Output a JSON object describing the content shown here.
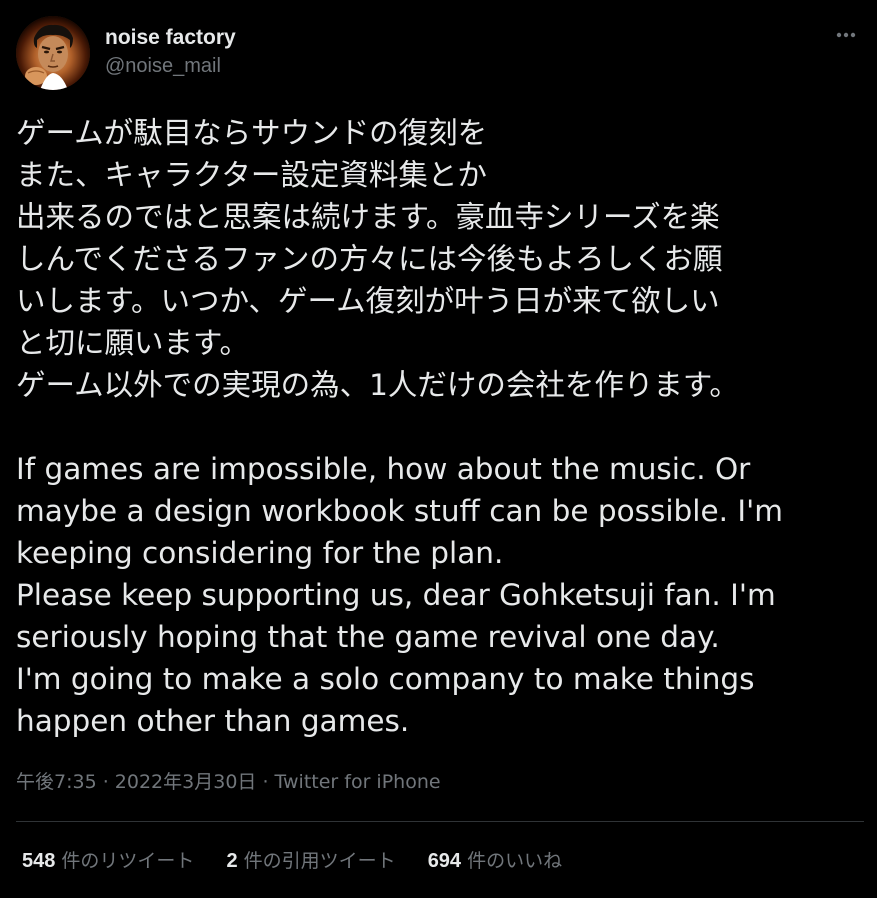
{
  "user": {
    "display_name": "noise factory",
    "handle": "@noise_mail"
  },
  "tweet": {
    "lines": [
      "ゲームが駄目ならサウンドの復刻を",
      "また、キャラクター設定資料集とか",
      "出来るのではと思案は続けます。豪血寺シリーズを楽",
      "しんでくださるファンの方々には今後もよろしくお願",
      "いします。いつか、ゲーム復刻が叶う日が来て欲しい",
      "と切に願います。",
      "ゲーム以外での実現の為、1人だけの会社を作ります。",
      "",
      "If games are impossible, how about the music. Or",
      "maybe a design workbook stuff can be possible. I'm",
      "keeping considering for the plan.",
      "Please keep supporting us, dear Gohketsuji fan. I'm",
      "seriously hoping that the game revival one day.",
      "I'm going to make a solo company to make things",
      "happen other than games."
    ],
    "time": "午後7:35",
    "separator": " · ",
    "date": "2022年3月30日",
    "source": "Twitter for iPhone"
  },
  "stats": {
    "retweets_count": "548",
    "retweets_label": " 件のリツイート",
    "quotes_count": "2",
    "quotes_label": " 件の引用ツイート",
    "likes_count": "694",
    "likes_label": " 件のいいね"
  },
  "icons": {
    "more": "more-horizontal-icon",
    "avatar": "avatar"
  },
  "colors": {
    "background": "#000000",
    "primary_text": "#e7e9ea",
    "secondary_text": "#71767b",
    "divider": "#2f3336"
  }
}
